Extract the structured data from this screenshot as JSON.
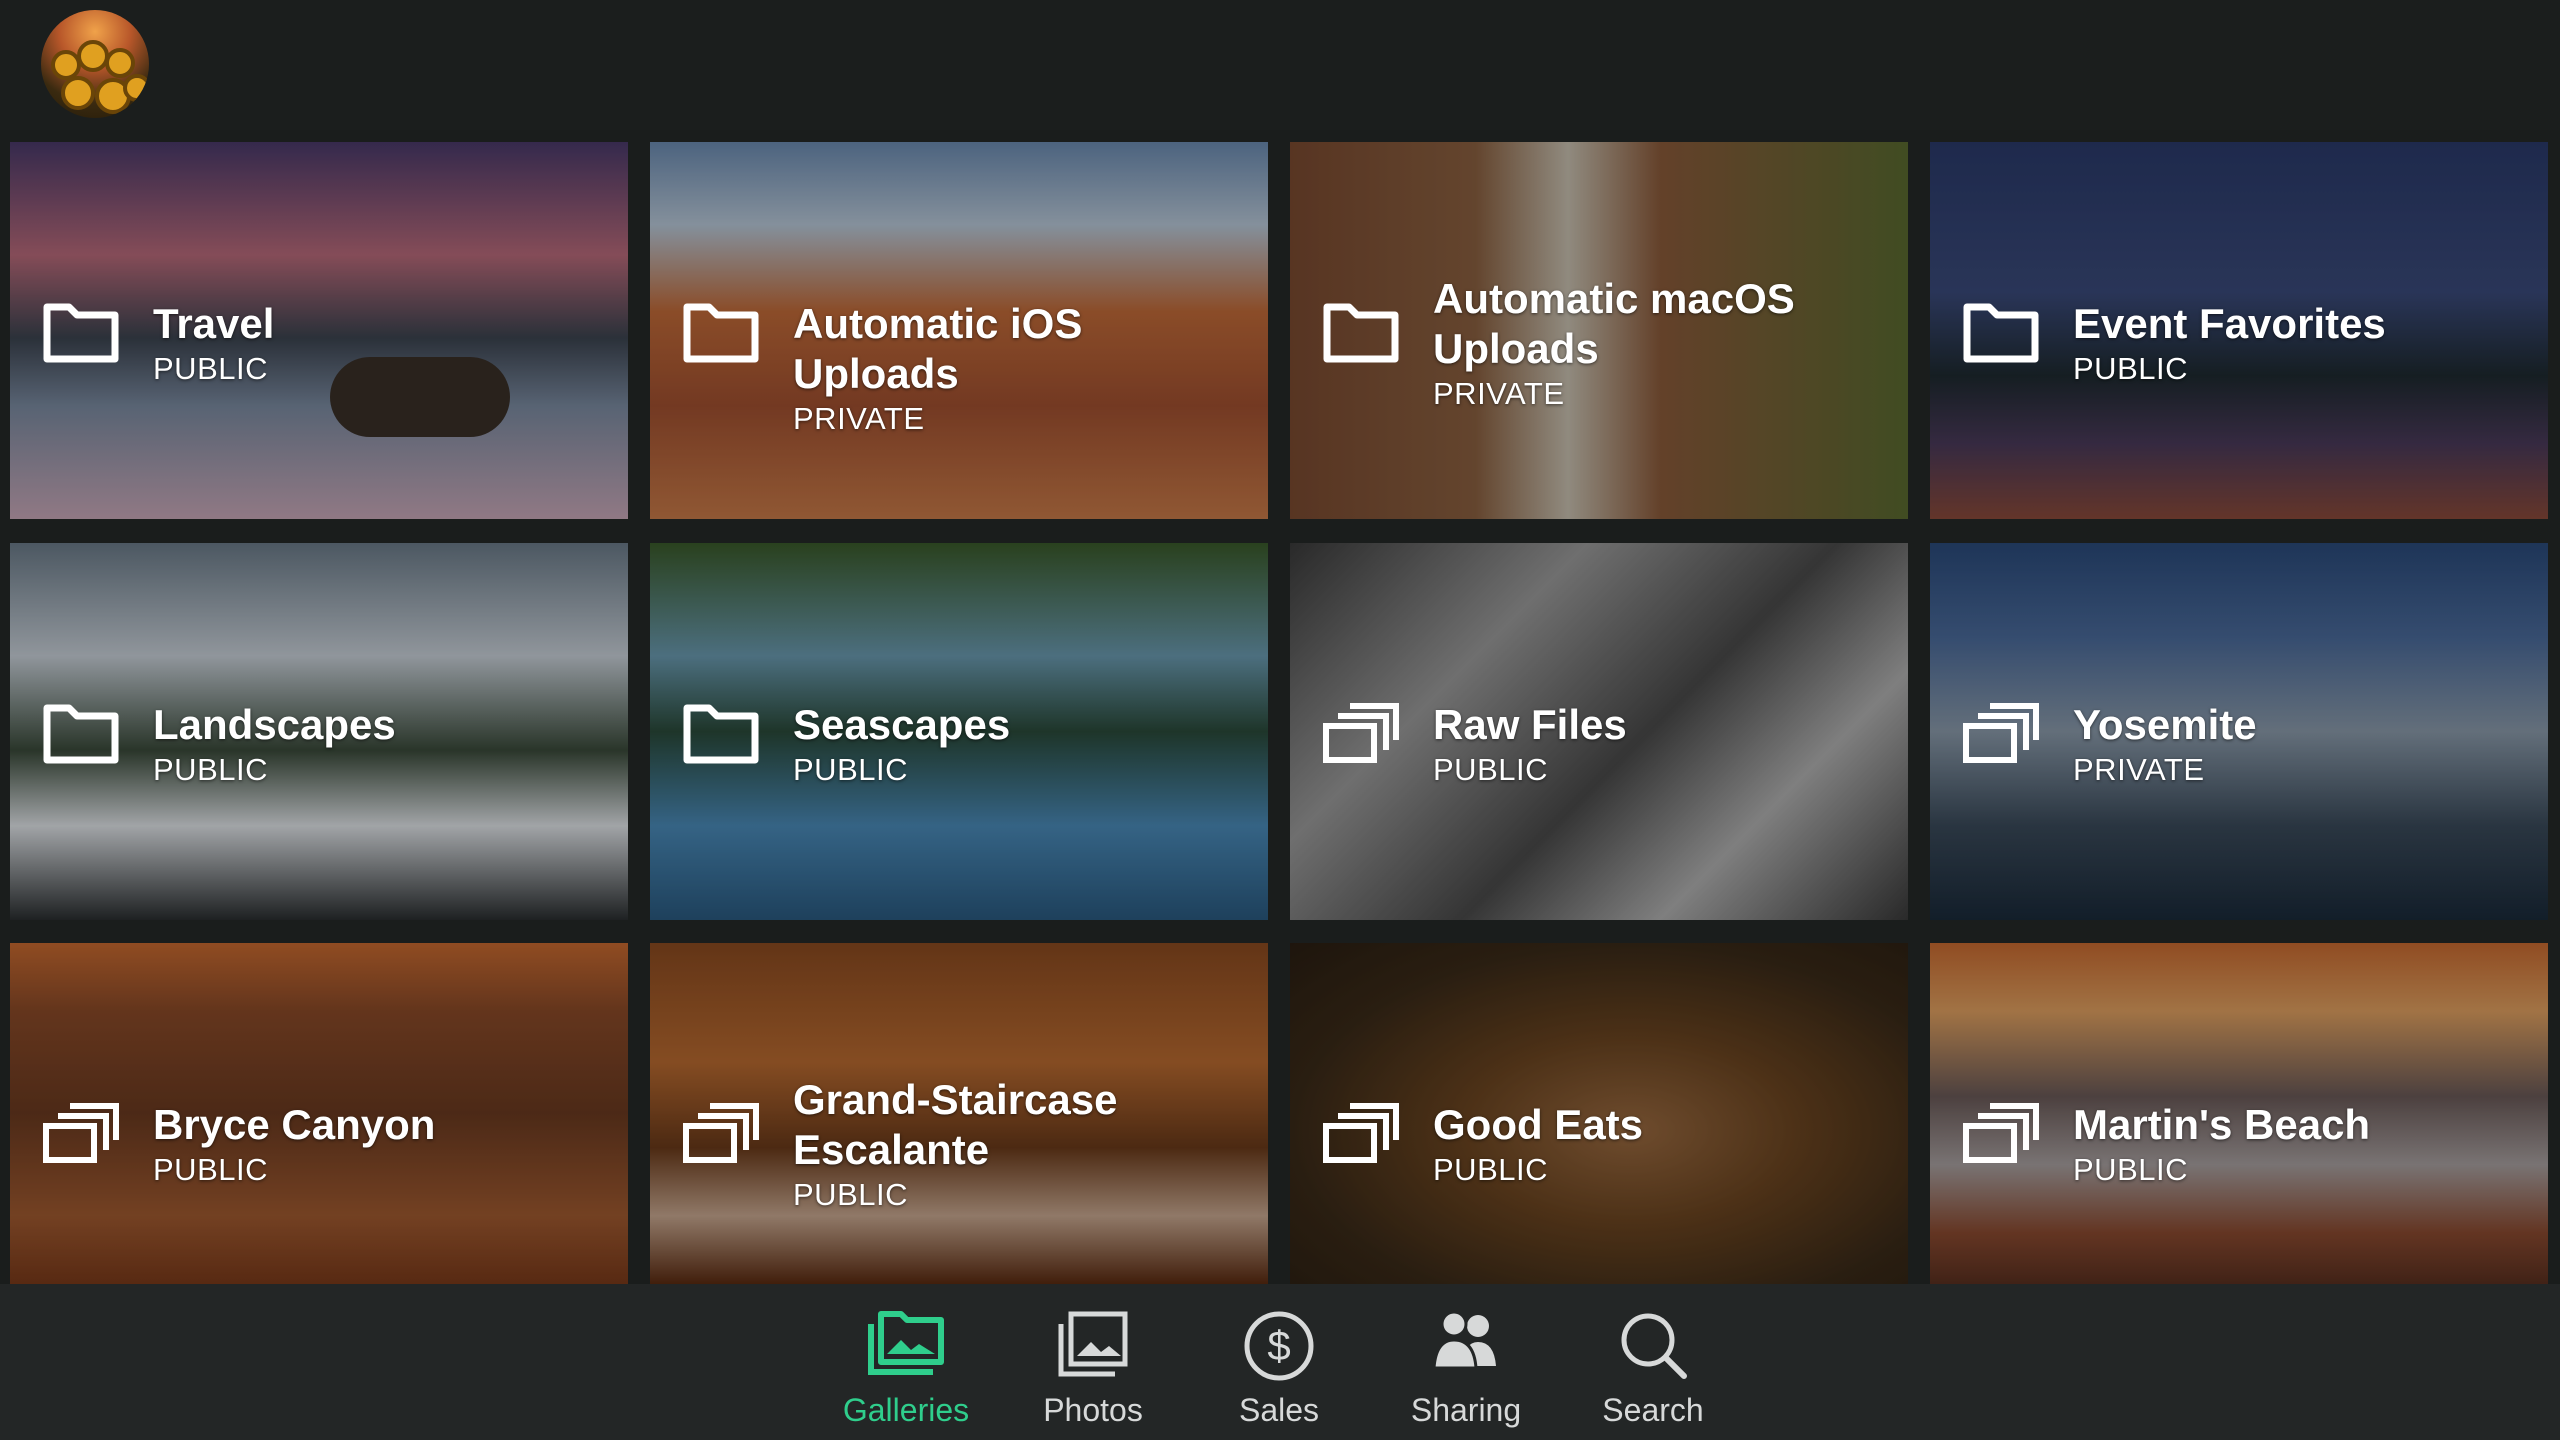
{
  "colors": {
    "accent": "#2fce8c",
    "topbar_bg": "#1b1e1d",
    "bottombar_bg": "#232626",
    "nav_text": "#d7d9d9"
  },
  "galleries": [
    {
      "title": "Travel",
      "privacy": "PUBLIC",
      "icon": "folder-icon"
    },
    {
      "title": "Automatic iOS Uploads",
      "privacy": "PRIVATE",
      "icon": "folder-icon"
    },
    {
      "title": "Automatic macOS Uploads",
      "privacy": "PRIVATE",
      "icon": "folder-icon"
    },
    {
      "title": "Event Favorites",
      "privacy": "PUBLIC",
      "icon": "folder-icon"
    },
    {
      "title": "Landscapes",
      "privacy": "PUBLIC",
      "icon": "folder-icon"
    },
    {
      "title": "Seascapes",
      "privacy": "PUBLIC",
      "icon": "folder-icon"
    },
    {
      "title": "Raw Files",
      "privacy": "PUBLIC",
      "icon": "gallery-stack-icon"
    },
    {
      "title": "Yosemite",
      "privacy": "PRIVATE",
      "icon": "gallery-stack-icon"
    },
    {
      "title": "Bryce Canyon",
      "privacy": "PUBLIC",
      "icon": "gallery-stack-icon"
    },
    {
      "title": "Grand-Staircase Escalante",
      "privacy": "PUBLIC",
      "icon": "gallery-stack-icon"
    },
    {
      "title": "Good Eats",
      "privacy": "PUBLIC",
      "icon": "gallery-stack-icon"
    },
    {
      "title": "Martin's Beach",
      "privacy": "PUBLIC",
      "icon": "gallery-stack-icon"
    }
  ],
  "nav": {
    "items": [
      {
        "label": "Galleries",
        "icon": "galleries-icon",
        "active": true
      },
      {
        "label": "Photos",
        "icon": "photos-icon",
        "active": false
      },
      {
        "label": "Sales",
        "icon": "dollar-icon",
        "active": false
      },
      {
        "label": "Sharing",
        "icon": "people-icon",
        "active": false
      },
      {
        "label": "Search",
        "icon": "search-icon",
        "active": false
      }
    ]
  }
}
